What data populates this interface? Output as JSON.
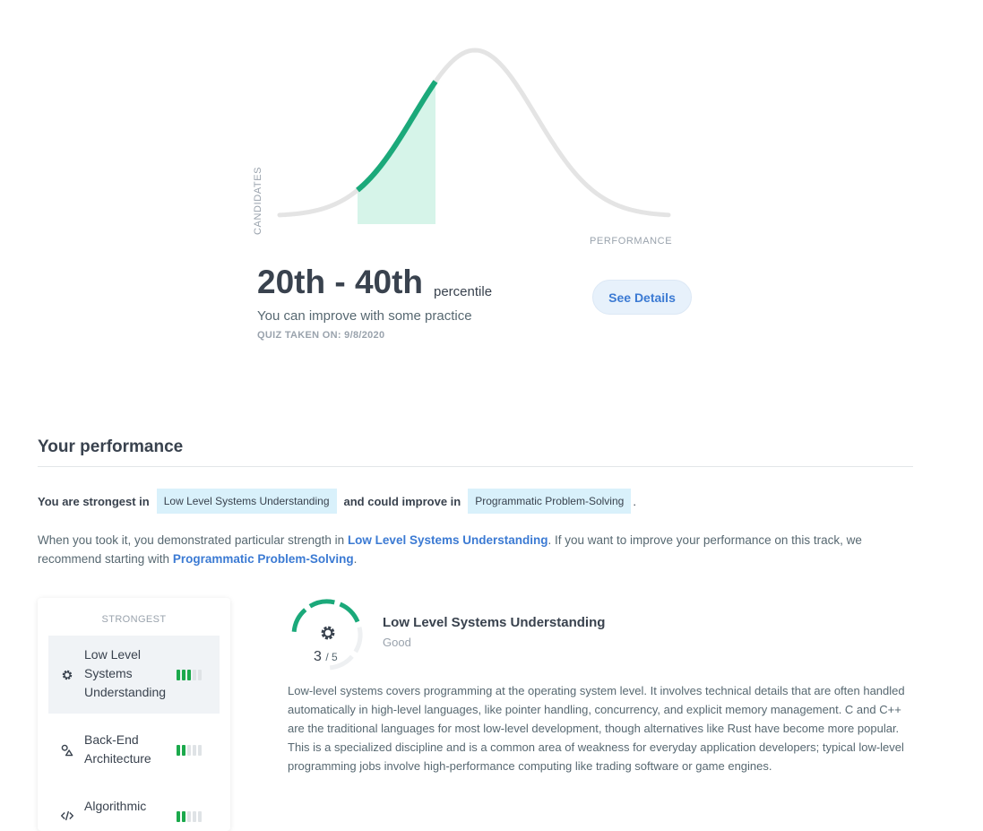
{
  "chart": {
    "y_axis_label": "CANDIDATES",
    "x_axis_label": "PERFORMANCE",
    "colors": {
      "curve": "#e4e4e4",
      "highlight_line": "#1ba97a",
      "highlight_fill": "#d6f4e9"
    }
  },
  "percentile": {
    "range": "20th - 40th",
    "word": "percentile",
    "subtitle": "You can improve with some practice",
    "quiz_date": "QUIZ TAKEN ON: 9/8/2020",
    "details_button": "See Details"
  },
  "performance": {
    "title": "Your performance",
    "strongest_prefix": "You are strongest in",
    "strongest_chip": "Low Level Systems Understanding",
    "improve_prefix": "and could improve in",
    "improve_chip": "Programmatic Problem-Solving",
    "improve_suffix": ".",
    "paragraph": {
      "part1": "When you took it, you demonstrated particular strength in ",
      "link1": "Low Level Systems Understanding",
      "part2": ". If you want to improve your performance on this track, we recommend starting with ",
      "link2": "Programmatic Problem-Solving",
      "part3": "."
    }
  },
  "sidebar": {
    "heading": "STRONGEST",
    "items": [
      {
        "label": "Low Level Systems Understanding",
        "icon": "gear-icon",
        "level": 3,
        "max": 5
      },
      {
        "label": "Back-End Architecture",
        "icon": "shapes-icon",
        "level": 2,
        "max": 5
      },
      {
        "label": "Algorithmic",
        "icon": "code-icon",
        "level": 2,
        "max": 5
      }
    ]
  },
  "detail": {
    "title": "Low Level Systems Understanding",
    "level": "Good",
    "score": "3",
    "score_max": "/ 5",
    "score_value": 3,
    "score_of": 5,
    "description": "Low-level systems covers programming at the operating system level. It involves technical details that are often handled automatically in high-level languages, like pointer handling, concurrency, and explicit memory management. C and C++ are the traditional languages for most low-level development, though alternatives like Rust have become more popular. This is a specialized discipline and is a common area of weakness for everyday application developers; typical low-level programming jobs involve high-performance computing like trading software or game engines."
  }
}
